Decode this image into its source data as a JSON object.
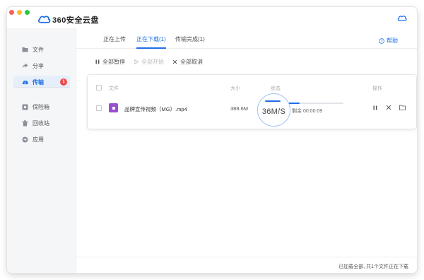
{
  "window": {
    "app_title": "360安全云盘"
  },
  "sidebar": {
    "items": [
      {
        "label": "文件",
        "icon": "folder-icon"
      },
      {
        "label": "分享",
        "icon": "share-icon"
      },
      {
        "label": "传输",
        "icon": "cloud-transfer-icon",
        "badge": "1",
        "active": true
      },
      {
        "label": "保险箱",
        "icon": "safe-icon"
      },
      {
        "label": "回收站",
        "icon": "trash-icon"
      },
      {
        "label": "应用",
        "icon": "apps-icon"
      }
    ]
  },
  "tabs": [
    {
      "label": "正在上传"
    },
    {
      "label": "正在下载(1)",
      "active": true
    },
    {
      "label": "传输完成(1)"
    }
  ],
  "help_label": "帮助",
  "toolbar": {
    "pause_all": "全部暂停",
    "start_all": "全部开始",
    "cancel_all": "全部取消"
  },
  "table": {
    "headers": {
      "file": "文件",
      "size": "大小",
      "status": "状态",
      "actions": "操作"
    },
    "rows": [
      {
        "file_name": "品牌宣传视频（MG）.mp4",
        "size": "388.6M",
        "speed": "36M/S",
        "remaining": "剩余 00:00:09",
        "progress": 0.45
      }
    ]
  },
  "status_bar": {
    "text": "已加载全部, 共1个文件正在下载"
  },
  "colors": {
    "accent": "#1f6fe6",
    "badge": "#f04848",
    "file_icon": "#9a4fd0",
    "sidebar_bg": "#f5f6f8"
  }
}
